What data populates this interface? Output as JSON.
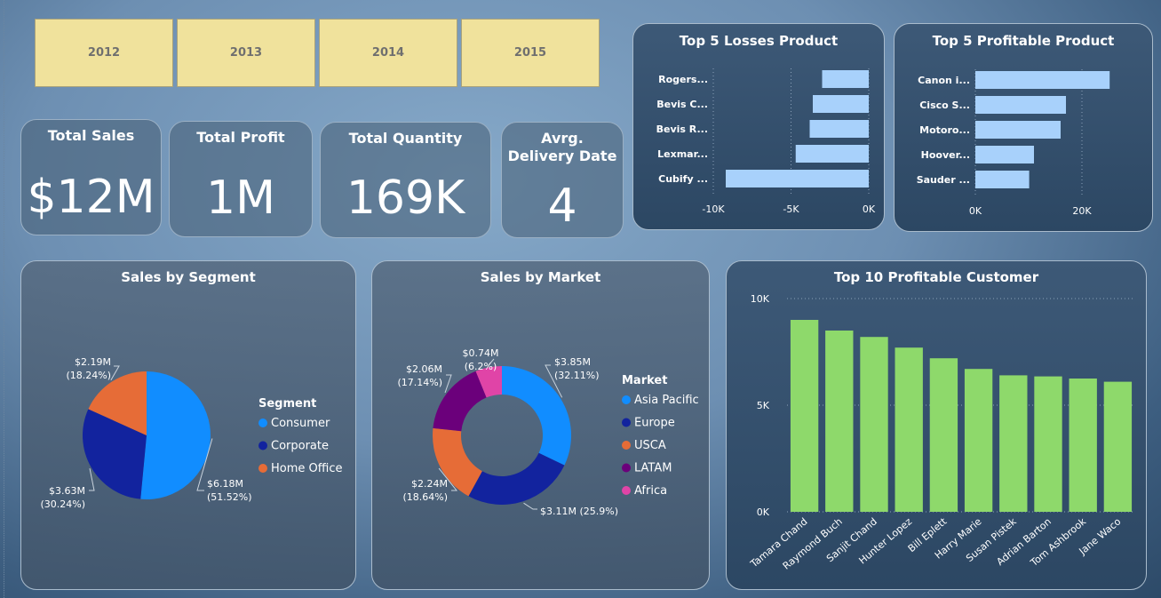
{
  "slicers": [
    "2012",
    "2013",
    "2014",
    "2015"
  ],
  "kpis": [
    {
      "title": "Total Sales",
      "value": "$12M"
    },
    {
      "title": "Total Profit",
      "value": "1M"
    },
    {
      "title": "Total Quantity",
      "value": "169K"
    },
    {
      "title": "Avrg. Delivery Date",
      "value": "4"
    }
  ],
  "panels": {
    "losses": "Top 5 Losses Product",
    "profitable": "Top 5 Profitable Product",
    "segment": "Sales by Segment",
    "market": "Sales by Market",
    "customers": "Top 10 Profitable Customer"
  },
  "colors": {
    "bar_light": "#a8d1fb",
    "bar_green": "#8ed96b",
    "slicer": "#f0e29c",
    "consumer": "#118dff",
    "corporate": "#12239e",
    "home_office": "#e66c37",
    "asia_pacific": "#118dff",
    "europe": "#12239e",
    "usca": "#e66c37",
    "latam": "#6b007b",
    "africa": "#e044a7"
  },
  "chart_data": [
    {
      "type": "bar",
      "orientation": "horizontal",
      "title": "Top 5 Losses Product",
      "categories": [
        "Rogers...",
        "Bevis C...",
        "Bevis R...",
        "Lexmar...",
        "Cubify ..."
      ],
      "values": [
        -3000,
        -3600,
        -3800,
        -4700,
        -9200
      ],
      "xlim": [
        -10000,
        0
      ],
      "ticks": [
        "-10K",
        "-5K",
        "0K"
      ],
      "tick_values": [
        -10000,
        -5000,
        0
      ]
    },
    {
      "type": "bar",
      "orientation": "horizontal",
      "title": "Top 5 Profitable Product",
      "categories": [
        "Canon i...",
        "Cisco S...",
        "Motoro...",
        "Hoover...",
        "Sauder ..."
      ],
      "values": [
        25200,
        17000,
        16000,
        11000,
        10100
      ],
      "xlim": [
        0,
        28000
      ],
      "ticks": [
        "0K",
        "20K"
      ],
      "tick_values": [
        0,
        20000
      ]
    },
    {
      "type": "pie",
      "title": "Sales by Segment",
      "legend_title": "Segment",
      "labels": [
        "Consumer",
        "Corporate",
        "Home Office"
      ],
      "values": [
        6.18,
        3.63,
        2.19
      ],
      "percent": [
        51.52,
        30.24,
        18.24
      ],
      "data_labels": [
        [
          "$6.18M",
          "(51.52%)"
        ],
        [
          "$3.63M",
          "(30.24%)"
        ],
        [
          "$2.19M",
          "(18.24%)"
        ]
      ]
    },
    {
      "type": "pie",
      "subtype": "donut",
      "title": "Sales by Market",
      "legend_title": "Market",
      "labels": [
        "Asia Pacific",
        "Europe",
        "USCA",
        "LATAM",
        "Africa"
      ],
      "values": [
        3.85,
        3.11,
        2.24,
        2.06,
        0.74
      ],
      "percent": [
        32.11,
        25.9,
        18.64,
        17.14,
        6.2
      ],
      "data_labels": [
        [
          "$3.85M",
          "(32.11%)"
        ],
        [
          "$3.11M (25.9%)"
        ],
        [
          "$2.24M",
          "(18.64%)"
        ],
        [
          "$2.06M",
          "(17.14%)"
        ],
        [
          "$0.74M",
          "(6.2%)"
        ]
      ]
    },
    {
      "type": "bar",
      "title": "Top 10 Profitable Customer",
      "categories": [
        "Tamara Chand",
        "Raymond Buch",
        "Sanjit Chand",
        "Hunter Lopez",
        "Bill Eplett",
        "Harry Marie",
        "Susan Pistek",
        "Adrian Barton",
        "Tom Ashbrook",
        "Jane Waco"
      ],
      "values": [
        9000,
        8500,
        8200,
        7700,
        7200,
        6700,
        6400,
        6350,
        6250,
        6100
      ],
      "ylim": [
        0,
        10000
      ],
      "ticks": [
        "0K",
        "5K",
        "10K"
      ],
      "tick_values": [
        0,
        5000,
        10000
      ]
    }
  ]
}
